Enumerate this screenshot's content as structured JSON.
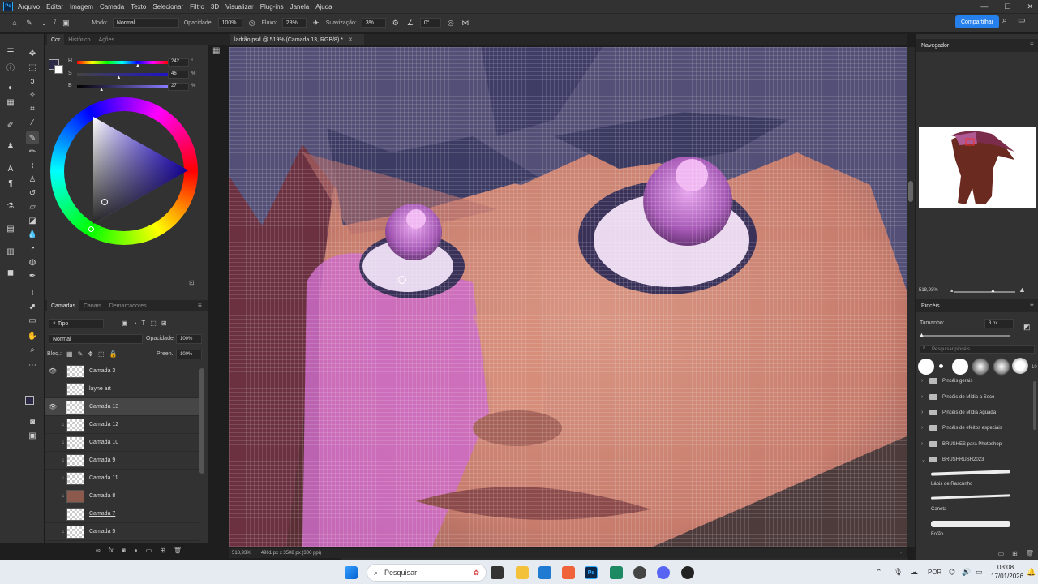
{
  "menubar": {
    "logo": "Ps",
    "items": [
      "Arquivo",
      "Editar",
      "Imagem",
      "Camada",
      "Texto",
      "Selecionar",
      "Filtro",
      "3D",
      "Visualizar",
      "Plug-ins",
      "Janela",
      "Ajuda"
    ]
  },
  "options": {
    "mode_label": "Modo:",
    "mode_value": "Normal",
    "opacity_label": "Opacidade:",
    "opacity_value": "100%",
    "flow_label": "Fluxo:",
    "flow_value": "28%",
    "smoothing_label": "Suavização:",
    "smoothing_value": "3%",
    "angle_value": "0°",
    "brush_size": "7",
    "share_label": "Compartilhar"
  },
  "color_panel": {
    "tabs": [
      "Cor",
      "Histórico",
      "Ações"
    ],
    "sliders": [
      {
        "label": "H",
        "value": "242",
        "unit": "°",
        "fraction": 0.67
      },
      {
        "label": "S",
        "value": "46",
        "unit": "%",
        "fraction": 0.46
      },
      {
        "label": "B",
        "value": "27",
        "unit": "%",
        "fraction": 0.27
      }
    ],
    "foreground_color": "#2b2946",
    "background_color": "#ffffff"
  },
  "layers_panel": {
    "tabs": [
      "Camadas",
      "Canais",
      "Demarcadores"
    ],
    "filter_value": "Tipo",
    "blend_value": "Normal",
    "opacity_label": "Opacidade:",
    "opacity_value": "100%",
    "lock_label": "Bloq.:",
    "fill_label": "Preen.:",
    "fill_value": "100%",
    "layers": [
      {
        "name": "Camada 3"
      },
      {
        "name": "layne art"
      },
      {
        "name": "Camada 13"
      },
      {
        "name": "Camada 12"
      },
      {
        "name": "Camada 10"
      },
      {
        "name": "Camada 9"
      },
      {
        "name": "Camada 11"
      },
      {
        "name": "Camada 8"
      },
      {
        "name": "Camada 7"
      },
      {
        "name": "Camada 5"
      }
    ]
  },
  "document": {
    "tab_title": "ladrão.psd @ 519% (Camada 13, RGB/8) *",
    "zoom": "518,93%",
    "dimensions": "4961 px x 3508 px (300 ppi)"
  },
  "navigator": {
    "title": "Navegador",
    "zoom": "518,93%"
  },
  "brushes": {
    "title": "Pincéis",
    "size_label": "Tamanho:",
    "size_value": "3 px",
    "search_placeholder": "Pesquisar pincéis",
    "preset_count": "10",
    "folders": [
      "Pincéis gerais",
      "Pincéis de Mídia a Seco",
      "Pincéis de Mídia Aguada",
      "Pincéis de efeitos especiais",
      "BRUSHES para Photoshop",
      "BRUSHRUSH2023"
    ],
    "brush_names": [
      "Lápis de Rascunho",
      "Caneta",
      "Fofão"
    ]
  },
  "taskbar": {
    "search_placeholder": "Pesquisar",
    "language": "POR",
    "time": "03:08",
    "date": "17/01/2026"
  }
}
